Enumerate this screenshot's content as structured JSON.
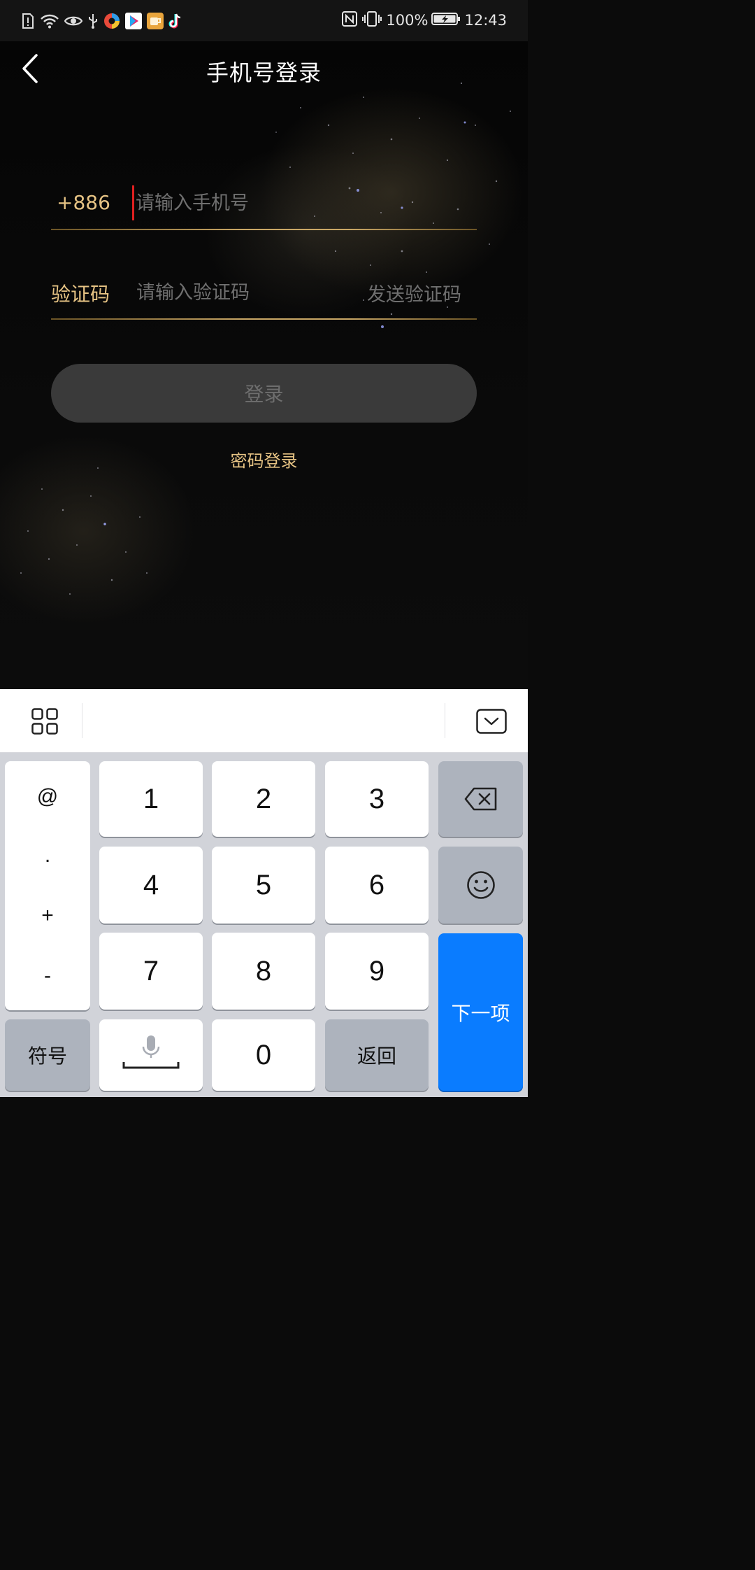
{
  "status_bar": {
    "battery": "100%",
    "time": "12:43"
  },
  "nav": {
    "title": "手机号登录"
  },
  "form": {
    "country_code": "+886",
    "phone_placeholder": "请输入手机号",
    "phone_value": "",
    "code_label": "验证码",
    "code_placeholder": "请输入验证码",
    "code_value": "",
    "send_code": "发送验证码",
    "login": "登录",
    "password_login": "密码登录"
  },
  "keyboard": {
    "symbols": [
      "@",
      ".",
      "+",
      "-"
    ],
    "digits": [
      "1",
      "2",
      "3",
      "4",
      "5",
      "6",
      "7",
      "8",
      "9",
      "0"
    ],
    "symbol_key": "符号",
    "return_key": "返回",
    "next_key": "下一项"
  },
  "colors": {
    "accent_gold": "#e6c384",
    "next_blue": "#0a7cff",
    "cursor_red": "#e02020"
  }
}
